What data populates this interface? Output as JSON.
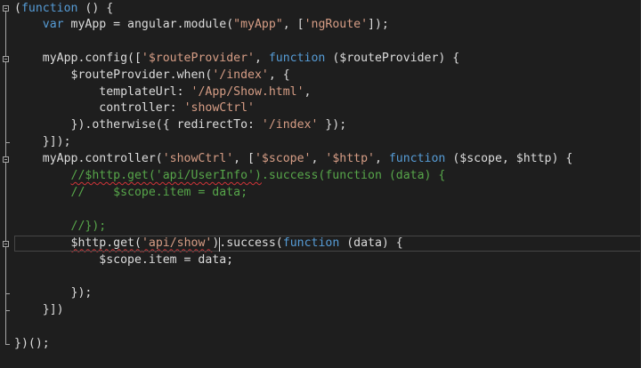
{
  "colors": {
    "background": "#1e1e1e",
    "text": "#dcdcdc",
    "keyword": "#569cd6",
    "string": "#d69d85",
    "comment": "#57a64a",
    "error_squiggle": "#d13438",
    "current_line_border": "#464646"
  },
  "editor": {
    "current_line": 14,
    "caret_line": 14,
    "lines": [
      {
        "tokens": [
          {
            "t": "(",
            "c": "plain"
          },
          {
            "t": "function",
            "c": "kw"
          },
          {
            "t": " () {",
            "c": "plain"
          }
        ]
      },
      {
        "tokens": [
          {
            "t": "    ",
            "c": "plain"
          },
          {
            "t": "var",
            "c": "kw"
          },
          {
            "t": " myApp = angular.module(",
            "c": "plain"
          },
          {
            "t": "\"myApp\"",
            "c": "str"
          },
          {
            "t": ", [",
            "c": "plain"
          },
          {
            "t": "'ngRoute'",
            "c": "str"
          },
          {
            "t": "]);",
            "c": "plain"
          }
        ]
      },
      {
        "tokens": []
      },
      {
        "tokens": [
          {
            "t": "    myApp.config([",
            "c": "plain"
          },
          {
            "t": "'$routeProvider'",
            "c": "str"
          },
          {
            "t": ", ",
            "c": "plain"
          },
          {
            "t": "function",
            "c": "kw"
          },
          {
            "t": " ($routeProvider) {",
            "c": "plain"
          }
        ]
      },
      {
        "tokens": [
          {
            "t": "        $routeProvider.when(",
            "c": "plain"
          },
          {
            "t": "'/index'",
            "c": "str"
          },
          {
            "t": ", {",
            "c": "plain"
          }
        ]
      },
      {
        "tokens": [
          {
            "t": "            templateUrl: ",
            "c": "plain"
          },
          {
            "t": "'/App/Show.html'",
            "c": "str"
          },
          {
            "t": ",",
            "c": "plain"
          }
        ]
      },
      {
        "tokens": [
          {
            "t": "            controller: ",
            "c": "plain"
          },
          {
            "t": "'showCtrl'",
            "c": "str"
          }
        ]
      },
      {
        "tokens": [
          {
            "t": "        }).otherwise({ redirectTo: ",
            "c": "plain"
          },
          {
            "t": "'/index'",
            "c": "str"
          },
          {
            "t": " });",
            "c": "plain"
          }
        ]
      },
      {
        "tokens": [
          {
            "t": "    }]);",
            "c": "plain"
          }
        ]
      },
      {
        "tokens": [
          {
            "t": "    myApp.controller(",
            "c": "plain"
          },
          {
            "t": "'showCtrl'",
            "c": "str"
          },
          {
            "t": ", [",
            "c": "plain"
          },
          {
            "t": "'$scope'",
            "c": "str"
          },
          {
            "t": ", ",
            "c": "plain"
          },
          {
            "t": "'$http'",
            "c": "str"
          },
          {
            "t": ", ",
            "c": "plain"
          },
          {
            "t": "function",
            "c": "kw"
          },
          {
            "t": " ($scope, $http) {",
            "c": "plain"
          }
        ]
      },
      {
        "tokens": [
          {
            "t": "        ",
            "c": "plain"
          },
          {
            "t": "//$http.get('api/UserInfo')",
            "c": "com",
            "squiggle": true
          },
          {
            "t": ".success(function (data) {",
            "c": "com"
          }
        ]
      },
      {
        "tokens": [
          {
            "t": "        //    $scope.item = data;",
            "c": "com"
          }
        ]
      },
      {
        "tokens": []
      },
      {
        "tokens": [
          {
            "t": "        //});",
            "c": "com"
          }
        ]
      },
      {
        "tokens": [
          {
            "t": "        ",
            "c": "plain"
          },
          {
            "t": "$http.get(",
            "c": "plain",
            "squiggle": true
          },
          {
            "t": "'api/show'",
            "c": "str",
            "squiggle": true
          },
          {
            "t": ").success(",
            "c": "plain"
          },
          {
            "t": "function",
            "c": "kw"
          },
          {
            "t": " (data) {",
            "c": "plain"
          }
        ]
      },
      {
        "tokens": [
          {
            "t": "            $scope.item = data;",
            "c": "plain"
          }
        ]
      },
      {
        "tokens": []
      },
      {
        "tokens": [
          {
            "t": "        });",
            "c": "plain"
          }
        ]
      },
      {
        "tokens": [
          {
            "t": "    }])",
            "c": "plain"
          }
        ]
      },
      {
        "tokens": []
      },
      {
        "tokens": [
          {
            "t": "})();",
            "c": "plain"
          }
        ]
      }
    ]
  }
}
